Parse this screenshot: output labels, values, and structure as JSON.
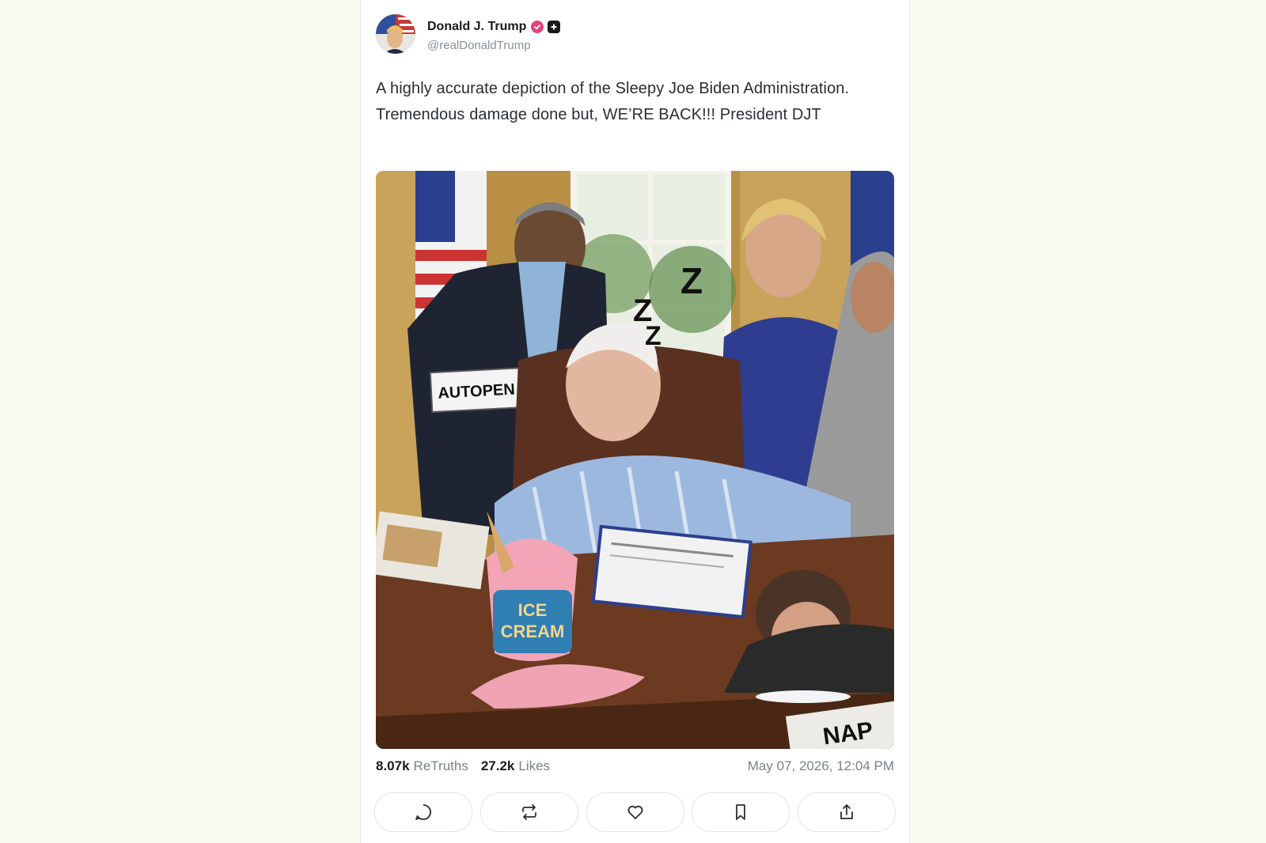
{
  "post": {
    "author_name": "Donald J. Trump",
    "author_handle": "@realDonaldTrump",
    "text": "A highly accurate depiction of the Sleepy Joe Biden Administration. Tremendous damage done but, WE’RE BACK!!! President DJT",
    "image": {
      "box_label": "AUTOPEN",
      "tub_label_line1": "ICE",
      "tub_label_line2": "CREAM",
      "sleep_letters": [
        "Z",
        "Z",
        "Z"
      ],
      "newspaper_text": "NAP"
    },
    "stats": {
      "retruths_count": "8.07k",
      "retruths_label": "ReTruths",
      "likes_count": "27.2k",
      "likes_label": "Likes",
      "timestamp": "May 07, 2026, 12:04 PM"
    },
    "actions": [
      {
        "name": "reply",
        "icon": "comment-icon"
      },
      {
        "name": "retruth",
        "icon": "repost-icon"
      },
      {
        "name": "like",
        "icon": "heart-icon"
      },
      {
        "name": "bookmark",
        "icon": "bookmark-icon"
      },
      {
        "name": "share",
        "icon": "share-icon"
      }
    ]
  },
  "colors": {
    "background": "#fbfaf1",
    "card": "#ffffff",
    "verified_badge": "#e0457b",
    "muted_text": "#7b8089"
  }
}
